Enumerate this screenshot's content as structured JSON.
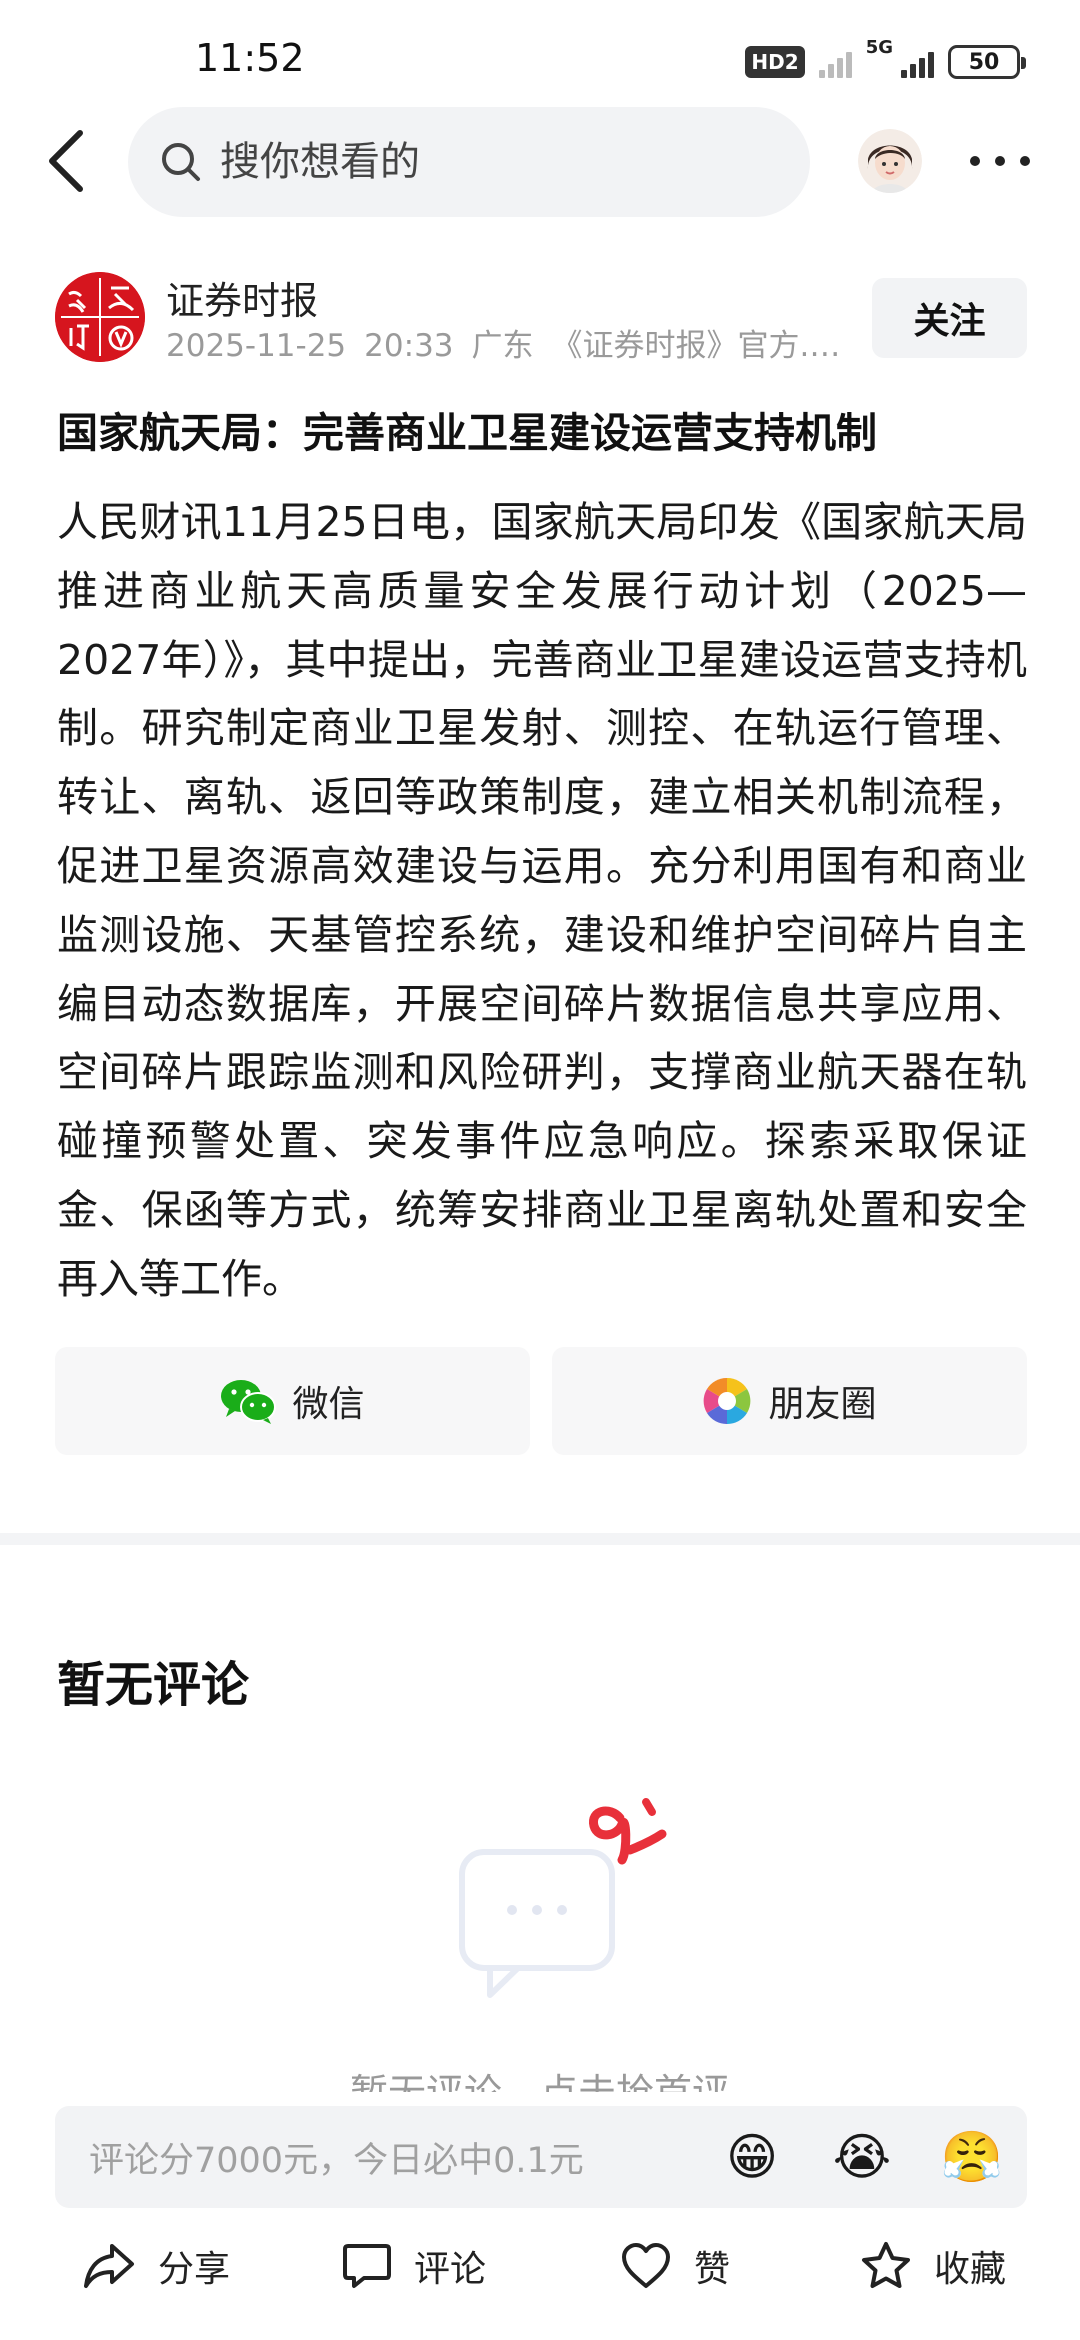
{
  "status_bar": {
    "time": "11:52",
    "network_badge": "HD2",
    "network_type": "5G",
    "battery": "50"
  },
  "search": {
    "placeholder": "搜你想看的"
  },
  "author": {
    "name": "证券时报",
    "date": "2025-11-25",
    "time": "20:33",
    "location": "广东",
    "description": "《证券时报》官方...",
    "follow_label": "关注",
    "logo_chars": [
      "证",
      "券",
      "时",
      "报"
    ]
  },
  "article": {
    "title": "国家航天局：完善商业卫星建设运营支持机制",
    "body": "人民财讯11月25日电，国家航天局印发《国家航天局推进商业航天高质量安全发展行动计划（2025—2027年）》，其中提出，完善商业卫星建设运营支持机制。研究制定商业卫星发射、测控、在轨运行管理、转让、离轨、返回等政策制度，建立相关机制流程，促进卫星资源高效建设与运用。充分利用国有和商业监测设施、天基管控系统，建设和维护空间碎片自主编目动态数据库，开展空间碎片数据信息共享应用、空间碎片跟踪监测和风险研判，支撑商业航天器在轨碰撞预警处置、突发事件应急响应。探索采取保证金、保函等方式，统筹安排商业卫星离轨处置和安全再入等工作。"
  },
  "share": {
    "wechat_label": "微信",
    "moments_label": "朋友圈"
  },
  "comments": {
    "title": "暂无评论",
    "empty_hint": "暂无评论，点击抢首评",
    "input_placeholder": "评论分7000元，今日必中0.1元",
    "emojis": [
      "😁",
      "😭",
      "😤"
    ]
  },
  "bottom_bar": {
    "share_label": "分享",
    "comment_label": "评论",
    "like_label": "赞",
    "favorite_label": "收藏"
  },
  "colors": {
    "brand_red": "#d6151e",
    "wechat_green": "#1aad19",
    "accent_red": "#e8303a"
  }
}
